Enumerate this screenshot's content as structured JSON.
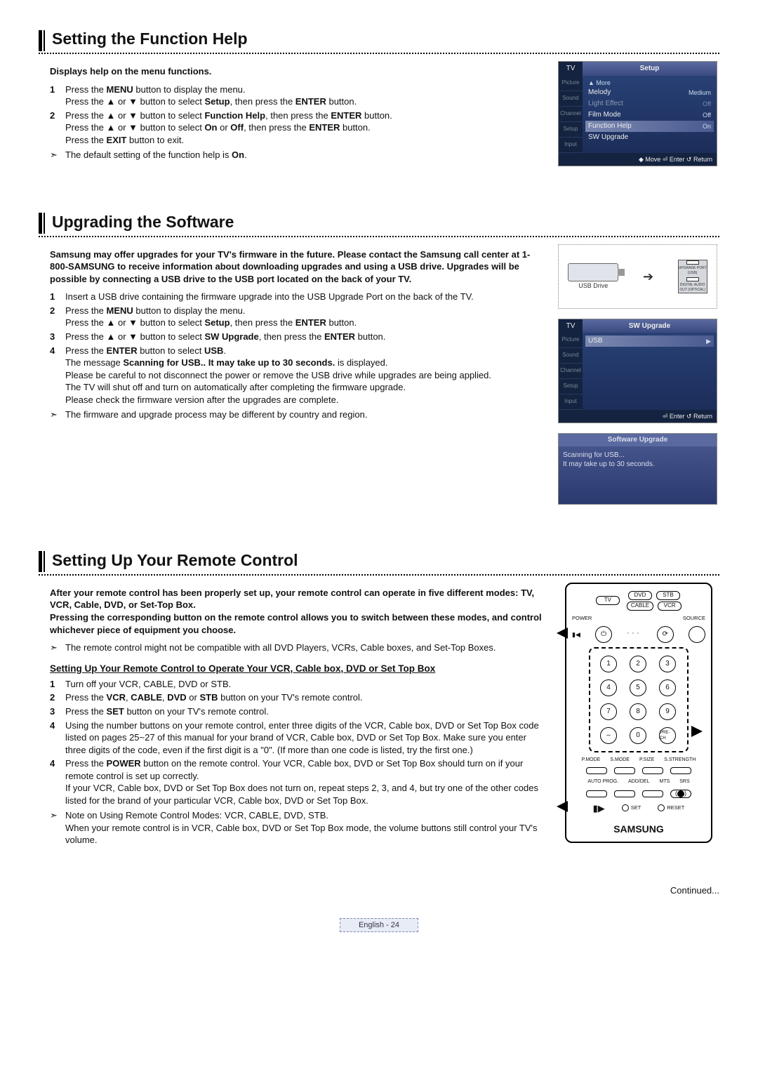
{
  "sections": {
    "s1": {
      "title": "Setting the Function Help",
      "intro": "Displays help on the menu functions.",
      "steps": [
        "Press the <b>MENU</b> button to display the menu.<br>Press the ▲ or ▼ button to select <b>Setup</b>, then press the <b>ENTER</b> button.",
        "Press the ▲ or ▼ button to select <b>Function Help</b>, then press the <b>ENTER</b> button.<br>Press the ▲ or ▼ button to select <b>On</b> or <b>Off</b>, then press the <b>ENTER</b> button.<br>Press the <b>EXIT</b> button to exit."
      ],
      "notes": [
        "The default setting of the function help is <b>On</b>."
      ]
    },
    "s2": {
      "title": "Upgrading the Software",
      "intro": "Samsung may offer upgrades for your TV's firmware in the future. Please contact the Samsung call center at 1-800-SAMSUNG to receive information about downloading upgrades and using a USB drive. Upgrades will be possible by connecting a USB drive to the USB port located on the back of your TV.",
      "steps": [
        "Insert a USB drive containing the firmware upgrade into the USB Upgrade Port on the back of the TV.",
        "Press the <b>MENU</b> button to display the menu.<br>Press the ▲ or ▼ button to select <b>Setup</b>, then press the <b>ENTER</b> button.",
        "Press the ▲ or ▼ button to select <b>SW Upgrade</b>, then press the <b>ENTER</b> button.",
        "Press the <b>ENTER</b> button to select <b>USB</b>.<br>The message <b>Scanning for USB.. It may take up to 30 seconds.</b> is displayed.<br>Please be careful to not disconnect the power or remove the USB drive while upgrades are being applied.<br>The TV will shut off and turn on automatically after completing the firmware upgrade.<br>Please check the firmware version after the upgrades are complete."
      ],
      "notes": [
        "The firmware and upgrade process may be different by country and region."
      ]
    },
    "s3": {
      "title": "Setting Up Your Remote Control",
      "intro": "After your remote control has been properly set up, your remote control can operate in five different modes: TV, VCR, Cable, DVD, or Set-Top Box.<br>Pressing the corresponding button on the remote control allows you to switch between these modes, and control whichever piece of equipment you choose.",
      "notes1": [
        "The remote control might not be compatible with all DVD Players, VCRs, Cable boxes, and Set-Top Boxes."
      ],
      "sub": "Setting Up Your Remote Control to Operate Your VCR, Cable box, DVD or Set Top Box",
      "steps": [
        "Turn off your VCR, CABLE, DVD or STB.",
        "Press the <b>VCR</b>, <b>CABLE</b>, <b>DVD</b> or <b>STB</b> button on your TV's remote control.",
        "Press the <b>SET</b> button on your TV's remote control.",
        "Using the number buttons on your remote control, enter three digits of the VCR, Cable box, DVD or Set Top Box code listed on pages 25~27 of this manual for your brand of VCR, Cable box, DVD or Set Top Box. Make sure you enter three digits of the code, even if the first digit is a \"0\". (If more than one code is listed, try the first one.)",
        "Press the <b>POWER</b> button on the remote control. Your VCR, Cable box, DVD or Set Top Box should turn on if your remote control is set up correctly.<br>If your VCR, Cable box, DVD or Set Top Box does not turn on, repeat steps 2, 3, and 4, but try one of the other codes listed for the brand of your particular VCR, Cable box, DVD or Set Top Box."
      ],
      "notes2": [
        "Note on Using Remote Control Modes: VCR, CABLE, DVD, STB.<br>When your remote control is in VCR, Cable box, DVD or Set Top Box mode, the volume buttons still control your TV's volume."
      ]
    }
  },
  "osd": {
    "setup": {
      "tv": "TV",
      "title": "Setup",
      "menubar": [
        "Picture",
        "Sound",
        "Channel",
        "Setup",
        "Input"
      ],
      "more": "▲ More",
      "rows": [
        {
          "k": "Melody",
          "v": "Medium"
        },
        {
          "k": "Light Effect",
          "v": "Off",
          "muted": true
        },
        {
          "k": "Film Mode",
          "v": "Off"
        },
        {
          "k": "Function Help",
          "v": "On",
          "hl": true
        },
        {
          "k": "SW Upgrade",
          "v": ""
        }
      ],
      "foot": "◆ Move   ⏎ Enter   ↺ Return"
    },
    "swu": {
      "tv": "TV",
      "title": "SW Upgrade",
      "menubar": [
        "Picture",
        "Sound",
        "Channel",
        "Setup",
        "Input"
      ],
      "rows": [
        {
          "k": "USB",
          "v": "▶",
          "hl": true
        }
      ],
      "foot": "⏎ Enter   ↺ Return"
    },
    "scan": {
      "title": "Software Upgrade",
      "line1": "Scanning for USB...",
      "line2": "It may take up to 30 seconds."
    },
    "usb": {
      "label": "USB Drive",
      "port1": "UPGRADE PORT (USB)",
      "port2": "DIGITAL AUDIO OUT (OPTICAL)"
    }
  },
  "remote": {
    "mode": {
      "tv": "TV",
      "dvd": "DVD",
      "stb": "STB",
      "cable": "CABLE",
      "vcr": "VCR"
    },
    "power": "POWER",
    "source": "SOURCE",
    "digits": [
      "1",
      "2",
      "3",
      "4",
      "5",
      "6",
      "7",
      "8",
      "9",
      "–",
      "0",
      "PRE-CH"
    ],
    "b1": [
      "P.MODE",
      "S.MODE",
      "P.SIZE",
      "S.STRENGTH"
    ],
    "b2": [
      "AUTO PROG.",
      "ADD/DEL",
      "MTS",
      "SRS"
    ],
    "set": "SET",
    "reset": "RESET",
    "brand": "SAMSUNG"
  },
  "footer": {
    "continued": "Continued...",
    "page": "English - 24"
  },
  "glyphs": {
    "arrow": "➣",
    "power": "⏻",
    "rewind": "▮◀"
  }
}
